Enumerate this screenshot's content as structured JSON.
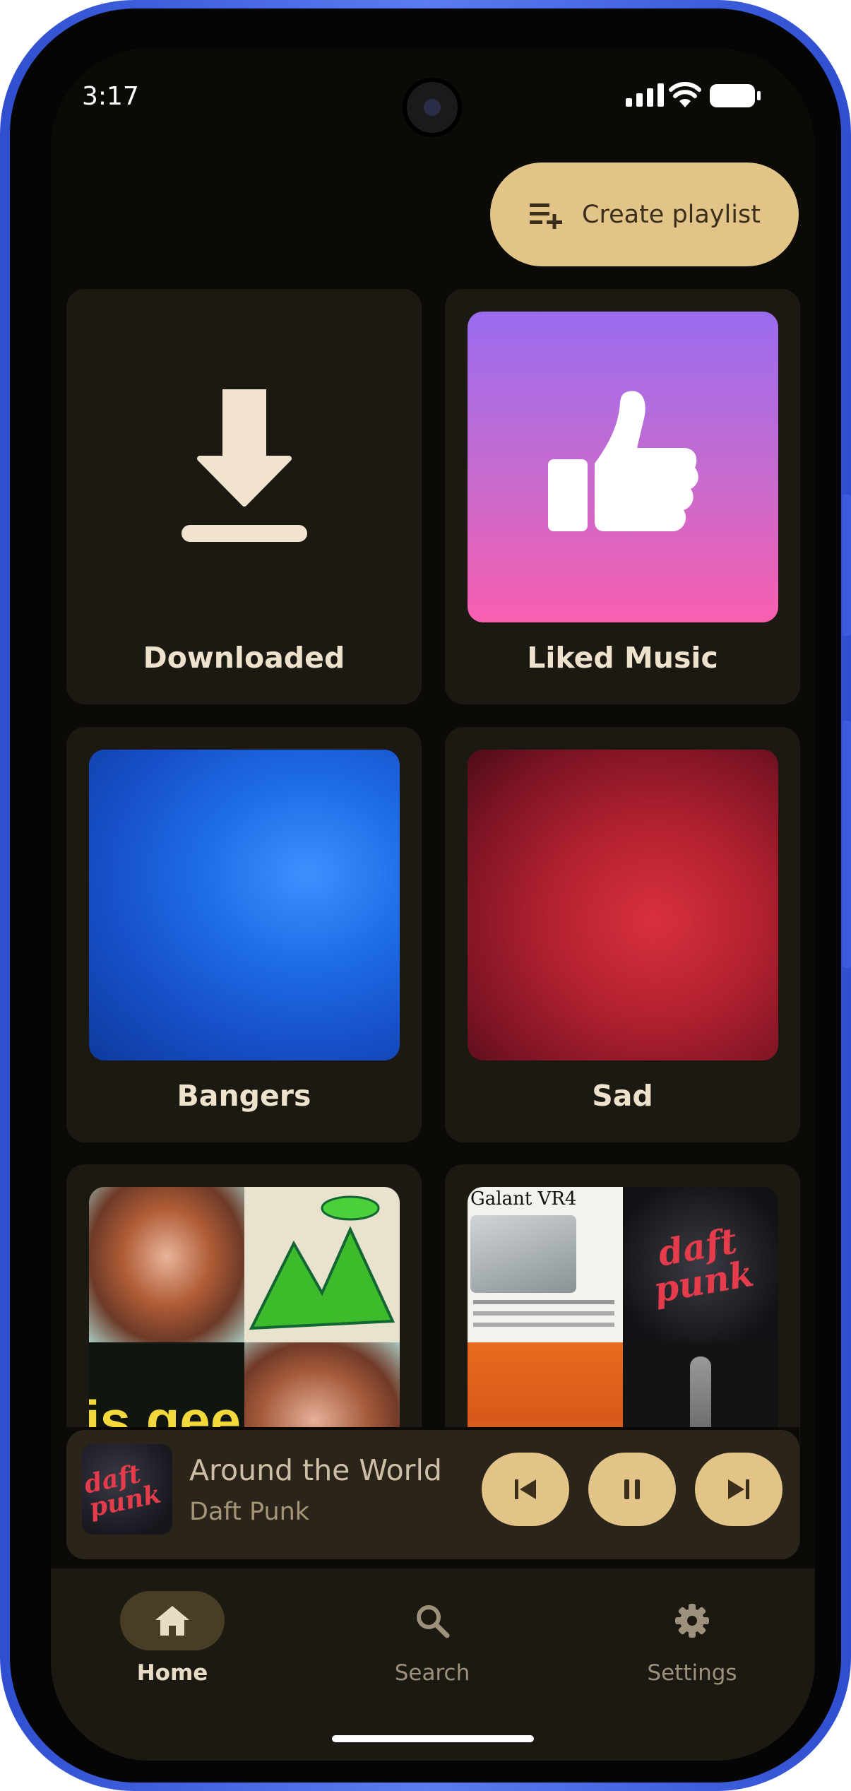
{
  "status": {
    "time": "3:17"
  },
  "header": {
    "create_label": "Create playlist"
  },
  "playlists": [
    {
      "label": "Downloaded"
    },
    {
      "label": "Liked Music"
    },
    {
      "label": "Bangers"
    },
    {
      "label": "Sad"
    }
  ],
  "album_text": {
    "geek": "is geek",
    "galant": "Galant VR4",
    "daft": "daft punk"
  },
  "now_playing": {
    "title": "Around the World",
    "artist": "Daft Punk",
    "art_text": "daft punk"
  },
  "nav": {
    "home": "Home",
    "search": "Search",
    "settings": "Settings"
  },
  "colors": {
    "accent": "#e2c489",
    "background": "#0b0a07",
    "card": "#1c1812",
    "frame": "#3a5be0"
  }
}
